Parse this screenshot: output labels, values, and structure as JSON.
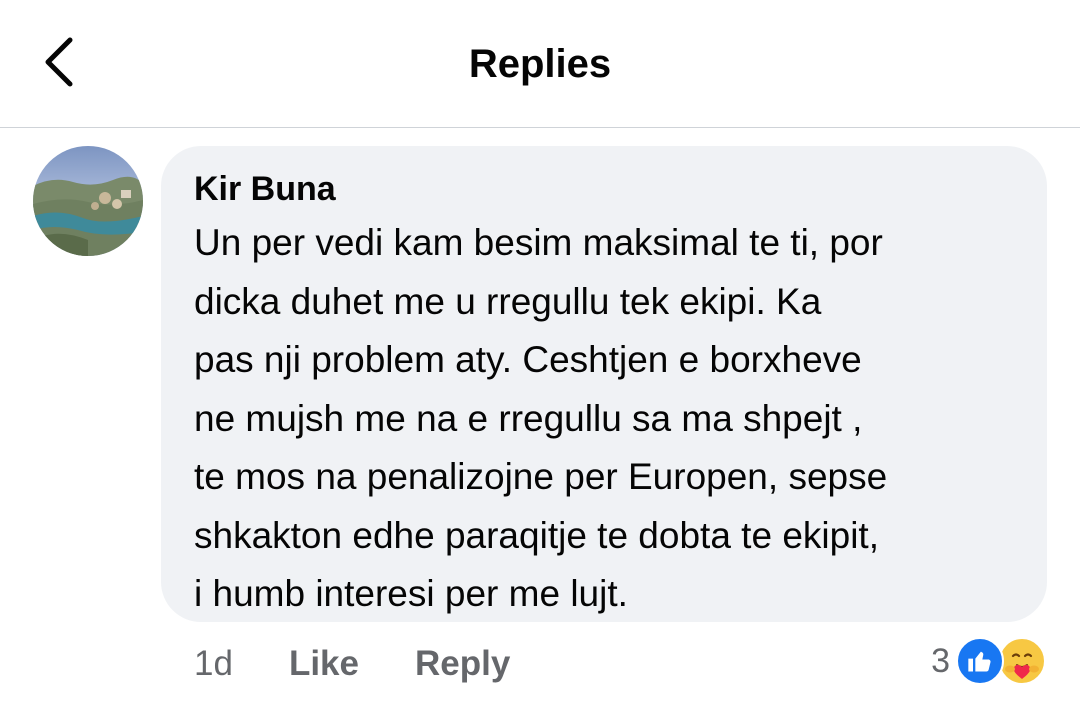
{
  "header": {
    "title": "Replies",
    "back_icon": "chevron-left-icon"
  },
  "comment": {
    "author": "Kir Buna",
    "text": "Un per vedi kam besim maksimal te ti, por\ndicka duhet me u rregullu tek ekipi. Ka\npas nji problem aty. Ceshtjen e borxheve\nne mujsh me na e rregullu sa ma shpejt ,\nte mos na penalizojne per Europen, sepse\nshkakton edhe paraqitje te dobta te ekipit,\ni humb interesi per me lujt.",
    "avatar_icon": "avatar-landscape",
    "bubble_color": "#f0f2f5"
  },
  "actions": {
    "time": "1d",
    "like_label": "Like",
    "reply_label": "Reply"
  },
  "reactions": {
    "count": "3",
    "icons": [
      "like-reaction-icon",
      "care-reaction-icon"
    ],
    "like_color": "#1877f2",
    "care_color": "#f7c843"
  }
}
